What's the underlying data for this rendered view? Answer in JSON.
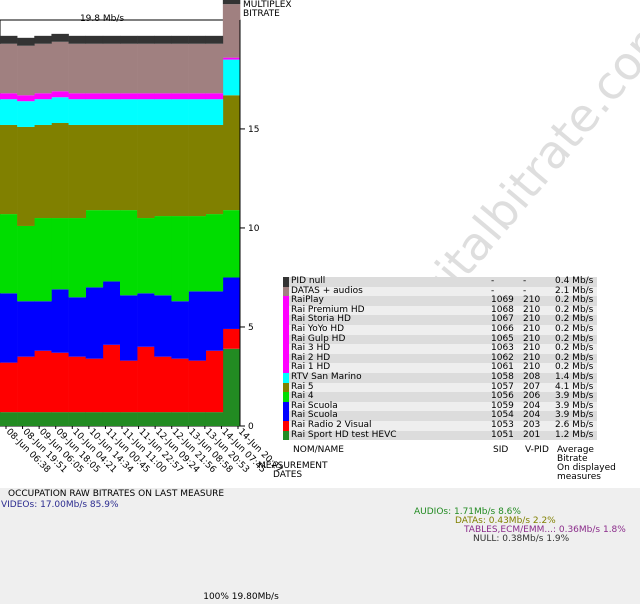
{
  "top_label": "19.8 Mb/s",
  "axis_title": [
    "MULTIPLEX",
    "BITRATE"
  ],
  "watermark": "www.digitalbitrate.com",
  "measurement_dates_label": [
    "MEASUREMENT",
    "DATES"
  ],
  "occupation_title": "OCCUPATION RAW BITRATES ON LAST MEASURE",
  "legend_headers": {
    "name": "NOM/NAME",
    "sid": "SID",
    "vpid": "V-PID",
    "avg": [
      "Average",
      "Bitrate",
      "On displayed",
      "measures"
    ]
  },
  "legend_rows": [
    {
      "name": "PID null",
      "sid": "-",
      "vpid": "-",
      "bitrate": "0.4 Mb/s",
      "color": "#333333"
    },
    {
      "name": "DATAS + audios",
      "sid": "-",
      "vpid": "-",
      "bitrate": "2.1 Mb/s",
      "color": "#a08080"
    },
    {
      "name": "RaiPlay",
      "sid": "1069",
      "vpid": "210",
      "bitrate": "0.2 Mb/s",
      "color": "#ff00ff"
    },
    {
      "name": "Rai Premium HD",
      "sid": "1068",
      "vpid": "210",
      "bitrate": "0.2 Mb/s",
      "color": "#ff00ff"
    },
    {
      "name": "Rai Storia HD",
      "sid": "1067",
      "vpid": "210",
      "bitrate": "0.2 Mb/s",
      "color": "#ff00ff"
    },
    {
      "name": "Rai YoYo HD",
      "sid": "1066",
      "vpid": "210",
      "bitrate": "0.2 Mb/s",
      "color": "#ff00ff"
    },
    {
      "name": "Rai Gulp HD",
      "sid": "1065",
      "vpid": "210",
      "bitrate": "0.2 Mb/s",
      "color": "#ff00ff"
    },
    {
      "name": "Rai 3 HD",
      "sid": "1063",
      "vpid": "210",
      "bitrate": "0.2 Mb/s",
      "color": "#ff00ff"
    },
    {
      "name": "Rai 2 HD",
      "sid": "1062",
      "vpid": "210",
      "bitrate": "0.2 Mb/s",
      "color": "#ff00ff"
    },
    {
      "name": "Rai 1 HD",
      "sid": "1061",
      "vpid": "210",
      "bitrate": "0.2 Mb/s",
      "color": "#ff00ff"
    },
    {
      "name": "RTV San Marino",
      "sid": "1058",
      "vpid": "208",
      "bitrate": "1.4 Mb/s",
      "color": "#00ffff"
    },
    {
      "name": "Rai 5",
      "sid": "1057",
      "vpid": "207",
      "bitrate": "4.1 Mb/s",
      "color": "#808000"
    },
    {
      "name": "Rai 4",
      "sid": "1056",
      "vpid": "206",
      "bitrate": "3.9 Mb/s",
      "color": "#00dd00"
    },
    {
      "name": "Rai Scuola",
      "sid": "1059",
      "vpid": "204",
      "bitrate": "3.9 Mb/s",
      "color": "#0000ff"
    },
    {
      "name": "Rai Scuola",
      "sid": "1054",
      "vpid": "204",
      "bitrate": "3.9 Mb/s",
      "color": "#0000ff"
    },
    {
      "name": "Rai Radio 2 Visual",
      "sid": "1053",
      "vpid": "203",
      "bitrate": "2.6 Mb/s",
      "color": "#ff0000"
    },
    {
      "name": "Rai Sport HD test HEVC",
      "sid": "1051",
      "vpid": "201",
      "bitrate": "1.2 Mb/s",
      "color": "#228b22"
    }
  ],
  "occupation": {
    "videos": "VIDEOs: 17.00Mb/s  85.9%",
    "audios": "AUDIOs: 1.71Mb/s  8.6%",
    "datas": "DATAs: 0.43Mb/s  2.2%",
    "tables": "TABLES,ECM/EMM...: 0.36Mb/s  1.8%",
    "null": "NULL: 0.38Mb/s  1.9%",
    "total": "100%  19.80Mb/s"
  },
  "chart_data": [
    {
      "type": "area",
      "title": "19.8 Mb/s",
      "ylabel": "MULTIPLEX BITRATE",
      "xlabel": "MEASUREMENT DATES",
      "y_ticks": [
        0,
        5,
        10,
        15
      ],
      "ylim": [
        0,
        20.5
      ],
      "x": [
        "08-Jun 06:38",
        "08-Jun 19:51",
        "09-Jun 06:05",
        "09-Jun 18:05",
        "10-Jun 04:21",
        "10-Jun 14:34",
        "11-Jun 00:45",
        "11-Jun 11:00",
        "11-Jun 22:57",
        "12-Jun 09:24",
        "12-Jun 21:56",
        "13-Jun 08:58",
        "13-Jun 20:53",
        "14-Jun 07:45",
        "14-Jun 20:27"
      ],
      "series_order_bottom_to_top": [
        "Rai Sport HD test HEVC",
        "Rai Radio 2 Visual",
        "Rai Scuola",
        "Rai 4",
        "Rai 5",
        "RTV San Marino",
        "Rai 1 HD",
        "DATAS + audios",
        "PID null"
      ],
      "series": [
        {
          "name": "Rai Sport HD test HEVC",
          "color": "#228b22",
          "values": [
            0.7,
            0.7,
            0.7,
            0.7,
            0.7,
            0.7,
            0.7,
            0.7,
            0.7,
            0.7,
            0.7,
            0.7,
            0.7,
            3.9
          ]
        },
        {
          "name": "Rai Radio 2 Visual",
          "color": "#ff0000",
          "values": [
            2.5,
            2.8,
            3.1,
            3.0,
            2.8,
            2.7,
            3.4,
            2.6,
            3.3,
            2.8,
            2.7,
            2.6,
            3.1,
            1.0
          ]
        },
        {
          "name": "Rai Scuola",
          "color": "#0000ff",
          "values": [
            3.5,
            2.8,
            2.5,
            3.2,
            3.0,
            3.6,
            3.2,
            3.3,
            2.7,
            3.1,
            2.9,
            3.5,
            3.0,
            2.6
          ]
        },
        {
          "name": "Rai 4",
          "color": "#00dd00",
          "values": [
            4.0,
            3.8,
            4.2,
            3.6,
            4.0,
            3.9,
            3.6,
            4.3,
            3.8,
            4.0,
            4.3,
            3.8,
            3.9,
            3.4
          ]
        },
        {
          "name": "Rai 5",
          "color": "#808000",
          "values": [
            4.5,
            5.0,
            4.7,
            4.8,
            4.7,
            4.3,
            4.3,
            4.3,
            4.7,
            4.6,
            4.6,
            4.6,
            4.5,
            5.8
          ]
        },
        {
          "name": "RTV San Marino",
          "color": "#00ffff",
          "values": [
            1.3,
            1.3,
            1.3,
            1.3,
            1.3,
            1.3,
            1.3,
            1.3,
            1.3,
            1.3,
            1.3,
            1.3,
            1.3,
            1.8
          ]
        },
        {
          "name": "Rai 1 HD",
          "color": "#ff00ff",
          "values": [
            0.3,
            0.3,
            0.3,
            0.3,
            0.3,
            0.3,
            0.3,
            0.3,
            0.3,
            0.3,
            0.3,
            0.3,
            0.3,
            0.1
          ]
        },
        {
          "name": "DATAS + audios",
          "color": "#a08080",
          "values": [
            2.5,
            2.5,
            2.5,
            2.5,
            2.5,
            2.5,
            2.5,
            2.5,
            2.5,
            2.5,
            2.5,
            2.5,
            2.5,
            2.7
          ]
        },
        {
          "name": "PID null",
          "color": "#333333",
          "values": [
            0.4,
            0.4,
            0.4,
            0.4,
            0.4,
            0.4,
            0.4,
            0.4,
            0.4,
            0.4,
            0.4,
            0.4,
            0.4,
            0.4
          ]
        }
      ]
    },
    {
      "type": "bar",
      "title": "OCCUPATION RAW BITRATES ON LAST MEASURE",
      "categories": [
        "VIDEOs",
        "AUDIOs",
        "DATAs",
        "TABLES,ECM/EMM...",
        "NULL"
      ],
      "values": [
        17.0,
        1.71,
        0.43,
        0.36,
        0.38
      ],
      "percent": [
        85.9,
        8.6,
        2.2,
        1.8,
        1.9
      ],
      "colors": [
        "#191970",
        "#228b22",
        "#808000",
        "#8b2c8b",
        "#333333"
      ],
      "total": 19.8
    }
  ]
}
